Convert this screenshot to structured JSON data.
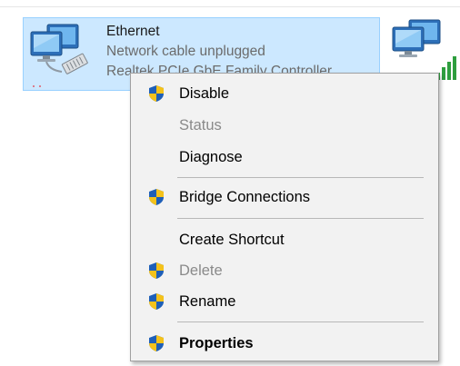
{
  "adapter": {
    "name": "Ethernet",
    "status": "Network cable unplugged",
    "device": "Realtek PCIe GbE Family Controller"
  },
  "context_menu": {
    "items": [
      {
        "label": "Disable",
        "shield": true,
        "enabled": true,
        "bold": false
      },
      {
        "label": "Status",
        "shield": false,
        "enabled": false,
        "bold": false
      },
      {
        "label": "Diagnose",
        "shield": false,
        "enabled": true,
        "bold": false
      },
      {
        "label": "Bridge Connections",
        "shield": true,
        "enabled": true,
        "bold": false
      },
      {
        "label": "Create Shortcut",
        "shield": false,
        "enabled": true,
        "bold": false
      },
      {
        "label": "Delete",
        "shield": true,
        "enabled": false,
        "bold": false
      },
      {
        "label": "Rename",
        "shield": true,
        "enabled": true,
        "bold": false
      },
      {
        "label": "Properties",
        "shield": true,
        "enabled": true,
        "bold": true
      }
    ]
  },
  "colors": {
    "selection_bg": "#cce8ff",
    "selection_border": "#99d1ff",
    "menu_bg": "#f2f2f2",
    "disabled_text": "#8a8a8a",
    "signal_green": "#2e9e3e"
  },
  "icons": [
    "network-adapter-icon",
    "uac-shield-icon",
    "signal-bars-icon"
  ]
}
